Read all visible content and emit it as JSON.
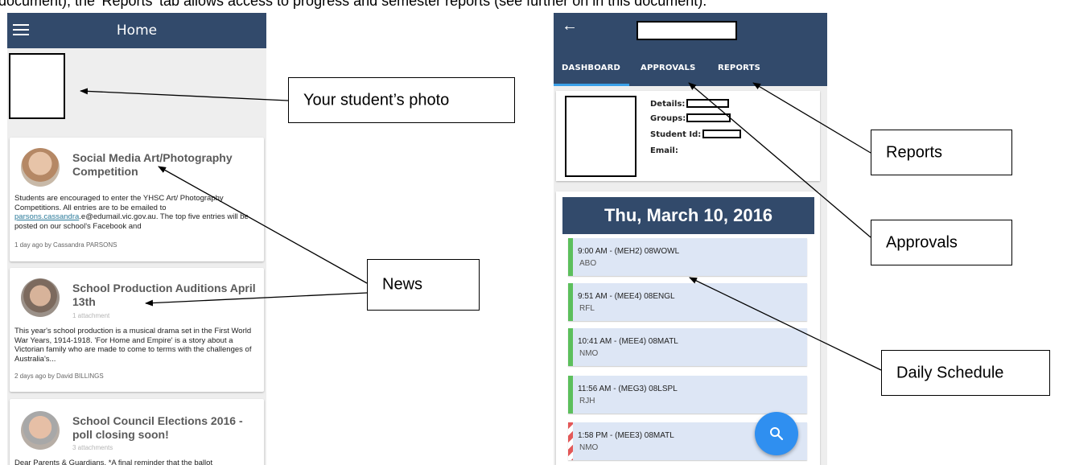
{
  "doc_text": "document), the 'Reports' tab allows access to progress and semester reports (see further on in this document).",
  "left_app": {
    "title": "Home",
    "news": [
      {
        "title": "Social Media Art/Photography Competition",
        "attachments": "",
        "body_pre": "Students are encouraged to enter the YHSC Art/ Photography Competitions. All entries are to be emailed to ",
        "body_link": "parsons.cassandra",
        "body_post": ".e@edumail.vic.gov.au. The top five entries will be posted on our school's Facebook and",
        "meta": "1 day ago by Cassandra PARSONS"
      },
      {
        "title": "School Production Auditions April 13th",
        "attachments": "1 attachment",
        "body": "This year's school production is a musical drama set in the First World War Years, 1914-1918. 'For Home and Empire' is a story about a Victorian family who are made to come to terms with the challenges of Australia's...",
        "meta": "2 days ago by David BILLINGS"
      },
      {
        "title": "School Council Elections 2016 - poll closing soon!",
        "attachments": "3 attachments",
        "body": "Dear Parents & Guardians, *A final reminder that the ballot"
      }
    ]
  },
  "right_app": {
    "tabs": [
      "DASHBOARD",
      "APPROVALS",
      "REPORTS"
    ],
    "details": {
      "details_label": "Details:",
      "groups_label": "Groups:",
      "student_id_label": "Student Id:",
      "email_label": "Email:"
    },
    "date": "Thu, March 10, 2016",
    "periods": [
      {
        "time": "9:00 AM - (MEH2) 08WOWL",
        "teacher": "ABO",
        "status": "normal"
      },
      {
        "time": "9:51 AM - (MEE4) 08ENGL",
        "teacher": "RFL",
        "status": "normal"
      },
      {
        "time": "10:41 AM - (MEE4) 08MATL",
        "teacher": "NMO",
        "status": "normal"
      },
      {
        "time": "11:56 AM - (MEG3) 08LSPL",
        "teacher": "RJH",
        "status": "normal"
      },
      {
        "time": "1:58 PM - (MEE3) 08MATL",
        "teacher": "NMO",
        "status": "alert"
      }
    ]
  },
  "callouts": {
    "photo": "Your student’s photo",
    "news": "News",
    "reports": "Reports",
    "approvals": "Approvals",
    "schedule": "Daily Schedule"
  }
}
